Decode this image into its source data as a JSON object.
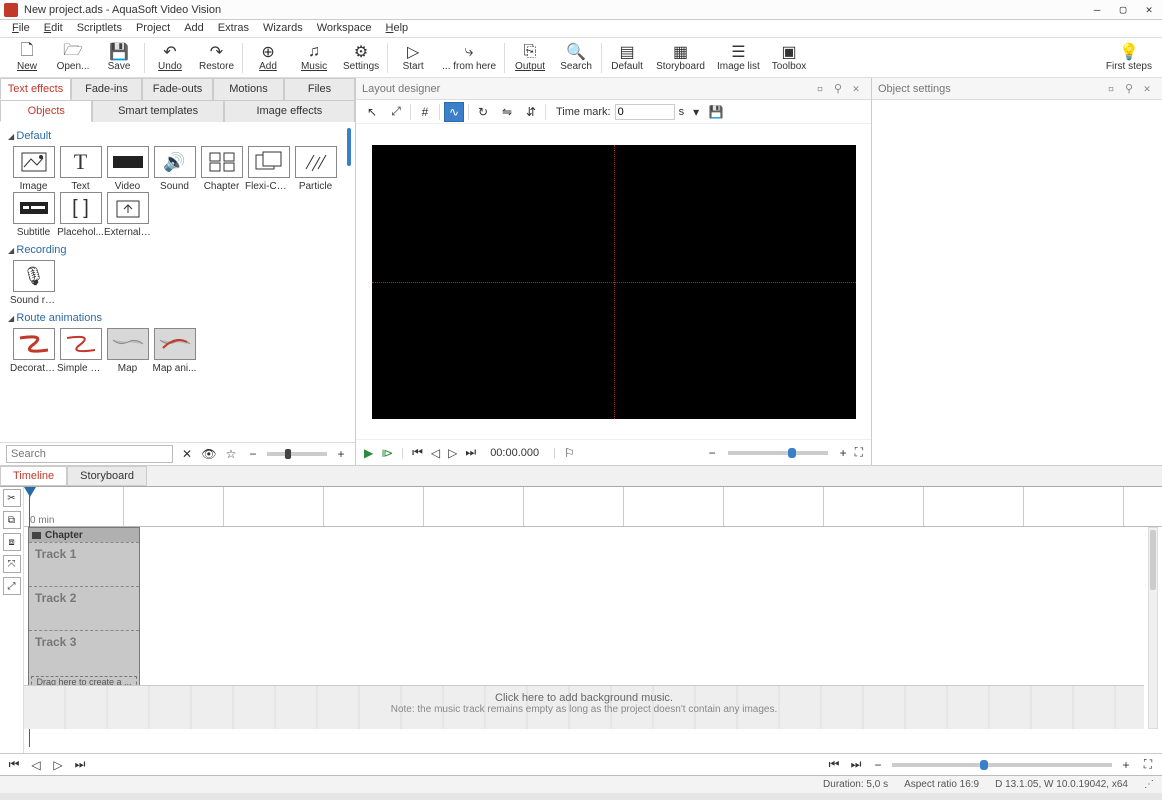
{
  "window": {
    "title": "New project.ads - AquaSoft Video Vision"
  },
  "menu": [
    "File",
    "Edit",
    "Scriptlets",
    "Project",
    "Add",
    "Extras",
    "Wizards",
    "Workspace",
    "Help"
  ],
  "toolbar": {
    "new": "New",
    "open": "Open...",
    "save": "Save",
    "undo": "Undo",
    "restore": "Restore",
    "add": "Add",
    "music": "Music",
    "settings": "Settings",
    "start": "Start",
    "fromhere": "... from here",
    "output": "Output",
    "search": "Search",
    "default": "Default",
    "storyboard": "Storyboard",
    "imagelist": "Image list",
    "toolbox": "Toolbox",
    "firststeps": "First steps"
  },
  "effects": {
    "tabs": [
      "Text effects",
      "Fade-ins",
      "Fade-outs",
      "Motions",
      "Files"
    ],
    "subtabs": [
      "Objects",
      "Smart templates",
      "Image effects"
    ]
  },
  "groups": {
    "default_hdr": "Default",
    "default": [
      "Image",
      "Text",
      "Video",
      "Sound",
      "Chapter",
      "Flexi-Coll...",
      "Particle",
      "Subtitle",
      "Placehol...",
      "External ..."
    ],
    "recording_hdr": "Recording",
    "recording": [
      "Sound re..."
    ],
    "route_hdr": "Route animations",
    "route": [
      "Decorate...",
      "Simple p...",
      "Map",
      "Map ani..."
    ]
  },
  "search": {
    "placeholder": "Search"
  },
  "designer": {
    "title": "Layout designer",
    "timemark": "Time mark:",
    "tm_value": "0",
    "tm_unit": "s"
  },
  "player": {
    "time": "00:00.000"
  },
  "objsettings": {
    "title": "Object settings"
  },
  "lower": {
    "tabs": [
      "Timeline",
      "Storyboard"
    ],
    "ruler": "0 min",
    "chapter": "Chapter",
    "tracks": [
      "Track 1",
      "Track 2",
      "Track 3"
    ],
    "drag": "Drag here to create a ...",
    "music": "Click here to add background music.",
    "music_note": "Note: the music track remains empty as long as the project doesn't contain any images."
  },
  "status": {
    "duration": "Duration: 5,0 s",
    "aspect": "Aspect ratio 16:9",
    "ver": "D 13.1.05, W 10.0.19042, x64"
  }
}
